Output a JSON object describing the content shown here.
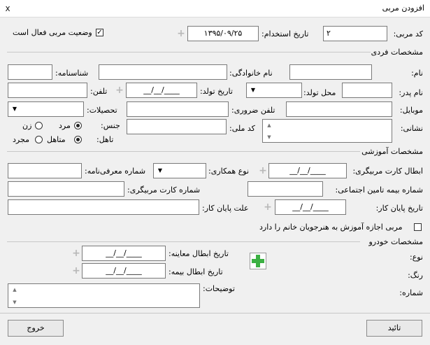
{
  "window": {
    "title": "افزودن مربی",
    "close_glyph": "x"
  },
  "header": {
    "coach_code_label": "کد مربی:",
    "coach_code_value": "۲",
    "hire_date_label": "تاریخ استخدام:",
    "hire_date_value": "۱۳۹۵/۰۹/۲۵",
    "active_status_label": "وضعیت مربی فعال است",
    "active_status_checked": true
  },
  "personal": {
    "section_title": "مشخصات فردی",
    "first_name_label": "نام:",
    "last_name_label": "نام خانوادگی:",
    "id_number_label": "شناسنامه:",
    "father_name_label": "نام پدر:",
    "birth_place_label": "محل تولد:",
    "birth_date_label": "تاریخ تولد:",
    "birth_date_value": "__/__/____",
    "phone_label": "تلفن:",
    "mobile_label": "موبایل:",
    "emergency_phone_label": "تلفن ضروری:",
    "education_label": "تحصیلات:",
    "address_label": "نشانی:",
    "national_code_label": "کد ملی:",
    "gender_label": "جنس:",
    "gender_male": "مرد",
    "gender_female": "زن",
    "marital_label": "تاهل:",
    "marital_married": "متاهل",
    "marital_single": "مجرد"
  },
  "education": {
    "section_title": "مشخصات آموزشی",
    "card_expiry_label": "ابطال کارت مربیگری:",
    "card_expiry_value": "__/__/____",
    "cooperation_type_label": "نوع همکاری:",
    "intro_number_label": "شماره معرفی‌نامه:",
    "insurance_number_label": "شماره بیمه تامین اجتماعی:",
    "coach_card_number_label": "شماره کارت مربیگری:",
    "end_date_label": "تاریخ پایان کار:",
    "end_date_value": "__/__/____",
    "end_reason_label": "علت پایان کار:",
    "female_permission_label": "مربی اجازه آموزش به هنرجویان خانم را دارد",
    "female_permission_checked": false
  },
  "vehicle": {
    "section_title": "مشخصات خودرو",
    "inspection_expiry_label": "تاریخ ابطال معاینه:",
    "inspection_expiry_value": "__/__/____",
    "insurance_expiry_label": "تاریخ ابطال بیمه:",
    "insurance_expiry_value": "__/__/____",
    "notes_label": "توضیحات:",
    "type_label": "نوع:",
    "color_label": "رنگ:",
    "number_label": "شماره:"
  },
  "footer": {
    "confirm_label": "تائید",
    "exit_label": "خروج"
  },
  "icons": {
    "plus": "+",
    "add_green": "green-plus",
    "dropdown": "▼",
    "scroll_up": "▲",
    "scroll_down": "▼",
    "check": "✓"
  },
  "colors": {
    "window_bg": "#f0f0f0",
    "green_plus": "#3cb043"
  }
}
